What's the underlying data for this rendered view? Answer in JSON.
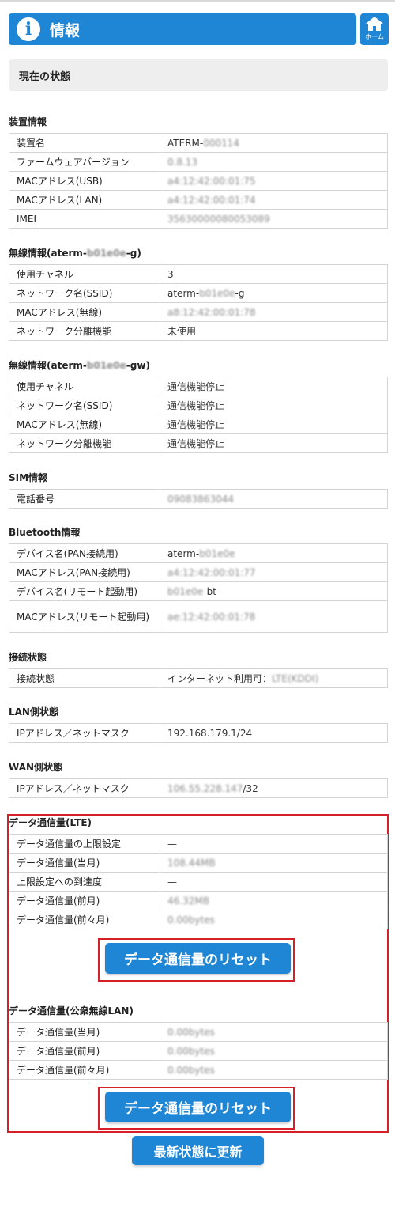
{
  "header": {
    "title": "情報",
    "info_icon": "info-icon",
    "home_label": "ホーム",
    "home_icon": "home-icon"
  },
  "status": {
    "label": "現在の状態"
  },
  "device": {
    "title": "装置情報",
    "rows": [
      {
        "k": "装置名",
        "v": "ATERM-000114"
      },
      {
        "k": "ファームウェアバージョン",
        "v": "0.8.13"
      },
      {
        "k": "MACアドレス(USB)",
        "v": "a4:12:42:00:01:75"
      },
      {
        "k": "MACアドレス(LAN)",
        "v": "a4:12:42:00:01:74"
      },
      {
        "k": "IMEI",
        "v": "35630000080053089"
      }
    ]
  },
  "wireless_g": {
    "title_prefix": "無線情報(aterm-",
    "title_blur": "b01e0e",
    "title_suffix": "-g)",
    "rows": [
      {
        "k": "使用チャネル",
        "v": "3"
      },
      {
        "k": "ネットワーク名(SSID)",
        "v_prefix": "aterm-",
        "v_blur": "b01e0e",
        "v_suffix": "-g"
      },
      {
        "k": "MACアドレス(無線)",
        "v": "a8:12:42:00:01:78"
      },
      {
        "k": "ネットワーク分離機能",
        "v": "未使用"
      }
    ]
  },
  "wireless_gw": {
    "title_prefix": "無線情報(aterm-",
    "title_blur": "b01e0e",
    "title_suffix": "-gw)",
    "rows": [
      {
        "k": "使用チャネル",
        "v": "通信機能停止"
      },
      {
        "k": "ネットワーク名(SSID)",
        "v": "通信機能停止"
      },
      {
        "k": "MACアドレス(無線)",
        "v": "通信機能停止"
      },
      {
        "k": "ネットワーク分離機能",
        "v": "通信機能停止"
      }
    ]
  },
  "sim": {
    "title": "SIM情報",
    "rows": [
      {
        "k": "電話番号",
        "v": "09083863044"
      }
    ]
  },
  "bluetooth": {
    "title": "Bluetooth情報",
    "rows": [
      {
        "k": "デバイス名(PAN接続用)",
        "v_prefix": "aterm-",
        "v_blur": "b01e0e"
      },
      {
        "k": "MACアドレス(PAN接続用)",
        "v": "a4:12:42:00:01:77"
      },
      {
        "k": "デバイス名(リモート起動用)",
        "v_blur": "b01e0e",
        "v_suffix": "-bt"
      },
      {
        "k": "MACアドレス(リモート起動用)",
        "v": "ae:12:42:00:01:78"
      }
    ]
  },
  "connection": {
    "title": "接続状態",
    "rows": [
      {
        "k": "接続状態",
        "v_prefix": "インターネット利用可：",
        "v_blur": "LTE(KDDI)"
      }
    ]
  },
  "lan": {
    "title": "LAN側状態",
    "rows": [
      {
        "k": "IPアドレス／ネットマスク",
        "v": "192.168.179.1/24"
      }
    ]
  },
  "wan": {
    "title": "WAN側状態",
    "rows": [
      {
        "k": "IPアドレス／ネットマスク",
        "v_blur": "106.55.228.147",
        "v_suffix": "/32"
      }
    ]
  },
  "data_lte": {
    "title": "データ通信量(LTE)",
    "rows": [
      {
        "k": "データ通信量の上限設定",
        "v": "—"
      },
      {
        "k": "データ通信量(当月)",
        "v": "108.44MB"
      },
      {
        "k": "上限設定への到達度",
        "v": "—"
      },
      {
        "k": "データ通信量(前月)",
        "v": "46.32MB"
      },
      {
        "k": "データ通信量(前々月)",
        "v": "0.00bytes"
      }
    ],
    "reset_label": "データ通信量のリセット"
  },
  "data_wlan": {
    "title": "データ通信量(公衆無線LAN)",
    "rows": [
      {
        "k": "データ通信量(当月)",
        "v": "0.00bytes"
      },
      {
        "k": "データ通信量(前月)",
        "v": "0.00bytes"
      },
      {
        "k": "データ通信量(前々月)",
        "v": "0.00bytes"
      }
    ],
    "reset_label": "データ通信量のリセット"
  },
  "refresh_label": "最新状態に更新",
  "colors": {
    "accent": "#1f86d6",
    "highlight": "#d61f26",
    "panel": "#eeeeee"
  }
}
